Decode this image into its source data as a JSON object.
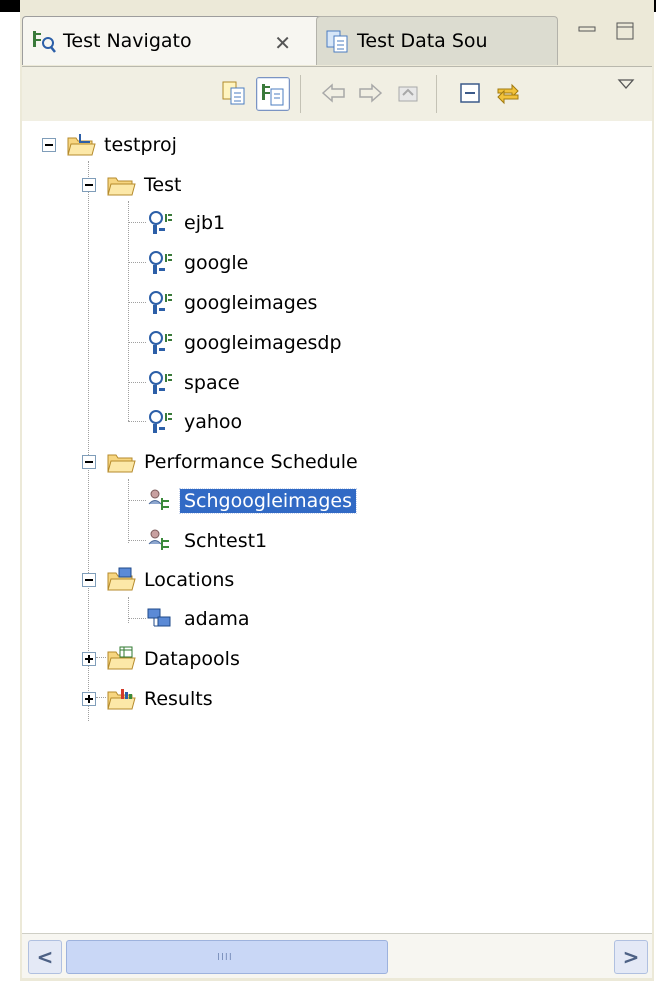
{
  "tabs": [
    {
      "label": "Test Navigato",
      "active": true
    },
    {
      "label": "Test Data Sou",
      "active": false
    }
  ],
  "tab_close_glyph": "✕",
  "toolbar": {
    "buttons": [
      "copy-icon",
      "link-with-editor-icon",
      "back-icon",
      "forward-icon",
      "up-icon",
      "collapse-all-icon",
      "sync-icon",
      "view-menu-icon"
    ]
  },
  "tree": {
    "root": "testproj",
    "test_folder": "Test",
    "tests": [
      "ejb1",
      "google",
      "googleimages",
      "googleimagesdp",
      "space",
      "yahoo"
    ],
    "schedule_folder": "Performance Schedule",
    "schedules": [
      "Schgoogleimages",
      "Schtest1"
    ],
    "selected": "Schgoogleimages",
    "locations_folder": "Locations",
    "locations": [
      "adama"
    ],
    "datapools_folder": "Datapools",
    "results_folder": "Results"
  },
  "scrollbar": {
    "grip": "IIII",
    "left_arrow": "<",
    "right_arrow": ">"
  },
  "colors": {
    "selection": "#316ac5",
    "frame": "#ece9d8"
  }
}
